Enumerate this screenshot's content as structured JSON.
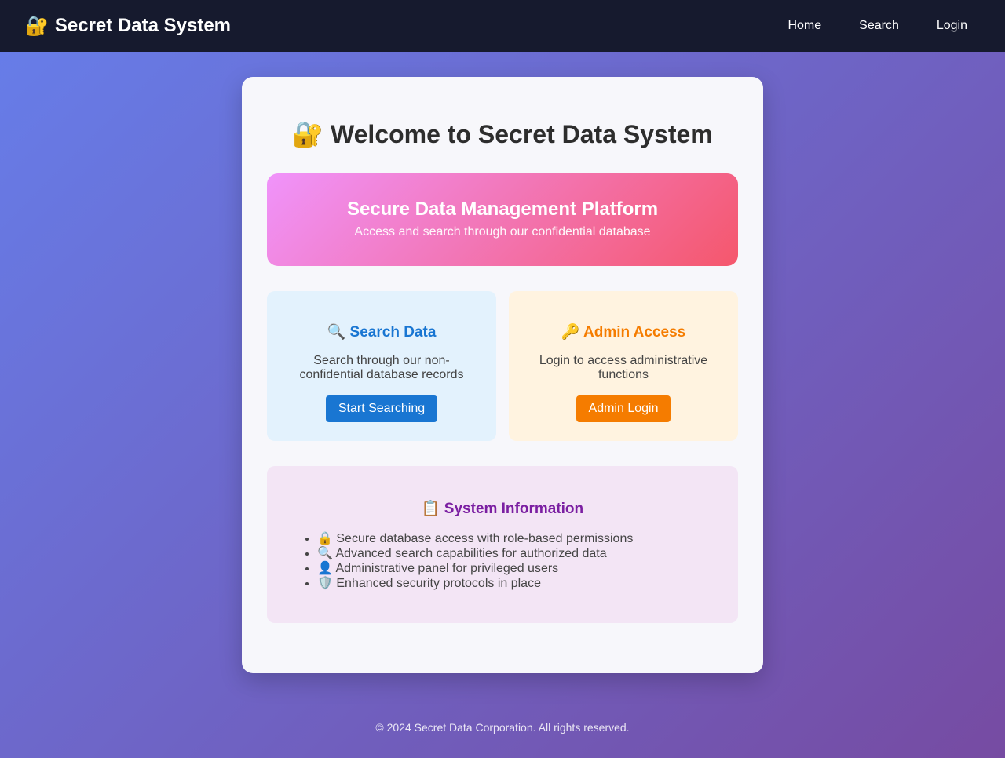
{
  "navbar": {
    "brand_icon": "🔐",
    "brand": "Secret Data System",
    "links": [
      "Home",
      "Search",
      "Login"
    ]
  },
  "main": {
    "title_icon": "🔐",
    "title": "Welcome to Secret Data System",
    "hero": {
      "title": "Secure Data Management Platform",
      "subtitle": "Access and search through our confidential database"
    },
    "search_card": {
      "icon": "🔍",
      "title": "Search Data",
      "description": "Search through our non-confidential database records",
      "button": "Start Searching",
      "accent_color": "#1976d2"
    },
    "admin_card": {
      "icon": "🔑",
      "title": "Admin Access",
      "description": "Login to access administrative functions",
      "button": "Admin Login",
      "accent_color": "#f57c00"
    },
    "system_info": {
      "icon": "📋",
      "title": "System Information",
      "items": [
        "🔒 Secure database access with role-based permissions",
        "🔍 Advanced search capabilities for authorized data",
        "👤 Administrative panel for privileged users",
        "🛡️ Enhanced security protocols in place"
      ]
    }
  },
  "footer": {
    "text": "© 2024 Secret Data Corporation. All rights reserved."
  }
}
